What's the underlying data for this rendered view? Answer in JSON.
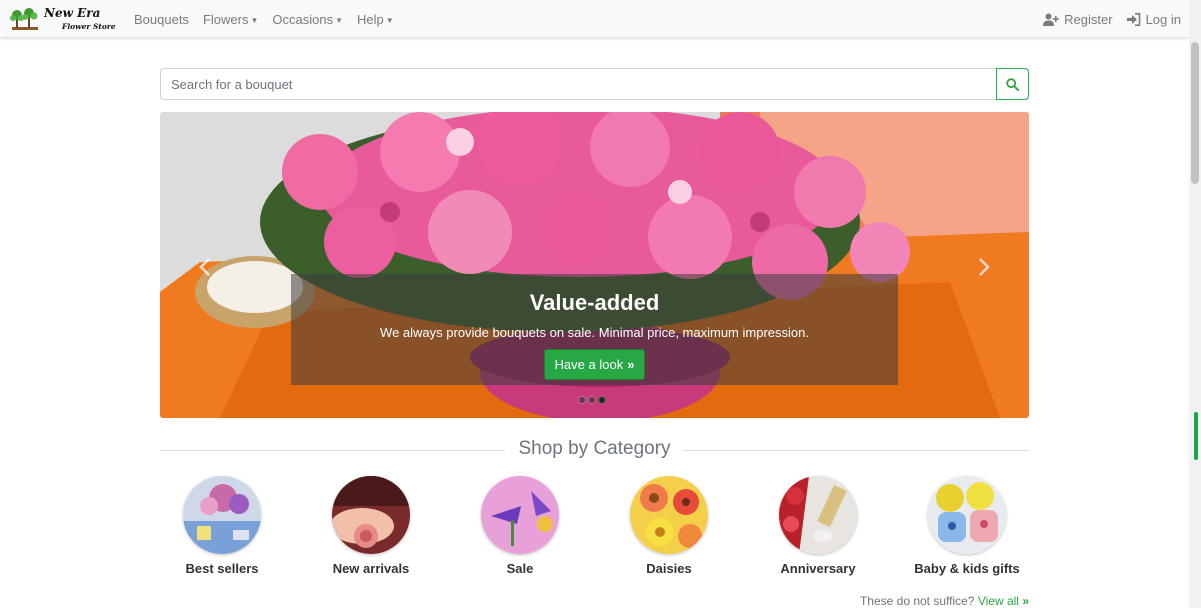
{
  "brand": {
    "name_line1": "New Era",
    "name_line2": "Flower Store"
  },
  "nav": {
    "items": [
      {
        "label": "Bouquets",
        "dropdown": false
      },
      {
        "label": "Flowers",
        "dropdown": true
      },
      {
        "label": "Occasions",
        "dropdown": true
      },
      {
        "label": "Help",
        "dropdown": true
      }
    ],
    "register_label": "Register",
    "login_label": "Log in"
  },
  "search": {
    "placeholder": "Search for a bouquet",
    "value": ""
  },
  "carousel": {
    "title": "Value-added",
    "description": "We always provide bouquets on sale. Minimal price, maximum impression.",
    "cta_label": "Have a look",
    "slide_count": 3,
    "active_slide": 3
  },
  "categories_section": {
    "heading": "Shop by Category",
    "items": [
      {
        "label": "Best sellers"
      },
      {
        "label": "New arrivals"
      },
      {
        "label": "Sale"
      },
      {
        "label": "Daisies"
      },
      {
        "label": "Anniversary"
      },
      {
        "label": "Baby & kids gifts"
      }
    ],
    "footer_text": "These do not suffice?",
    "view_all_label": "View all"
  },
  "colors": {
    "accent": "#28a745",
    "navbar_bg": "#f8f9fa",
    "muted_text": "#7b7b7b"
  }
}
